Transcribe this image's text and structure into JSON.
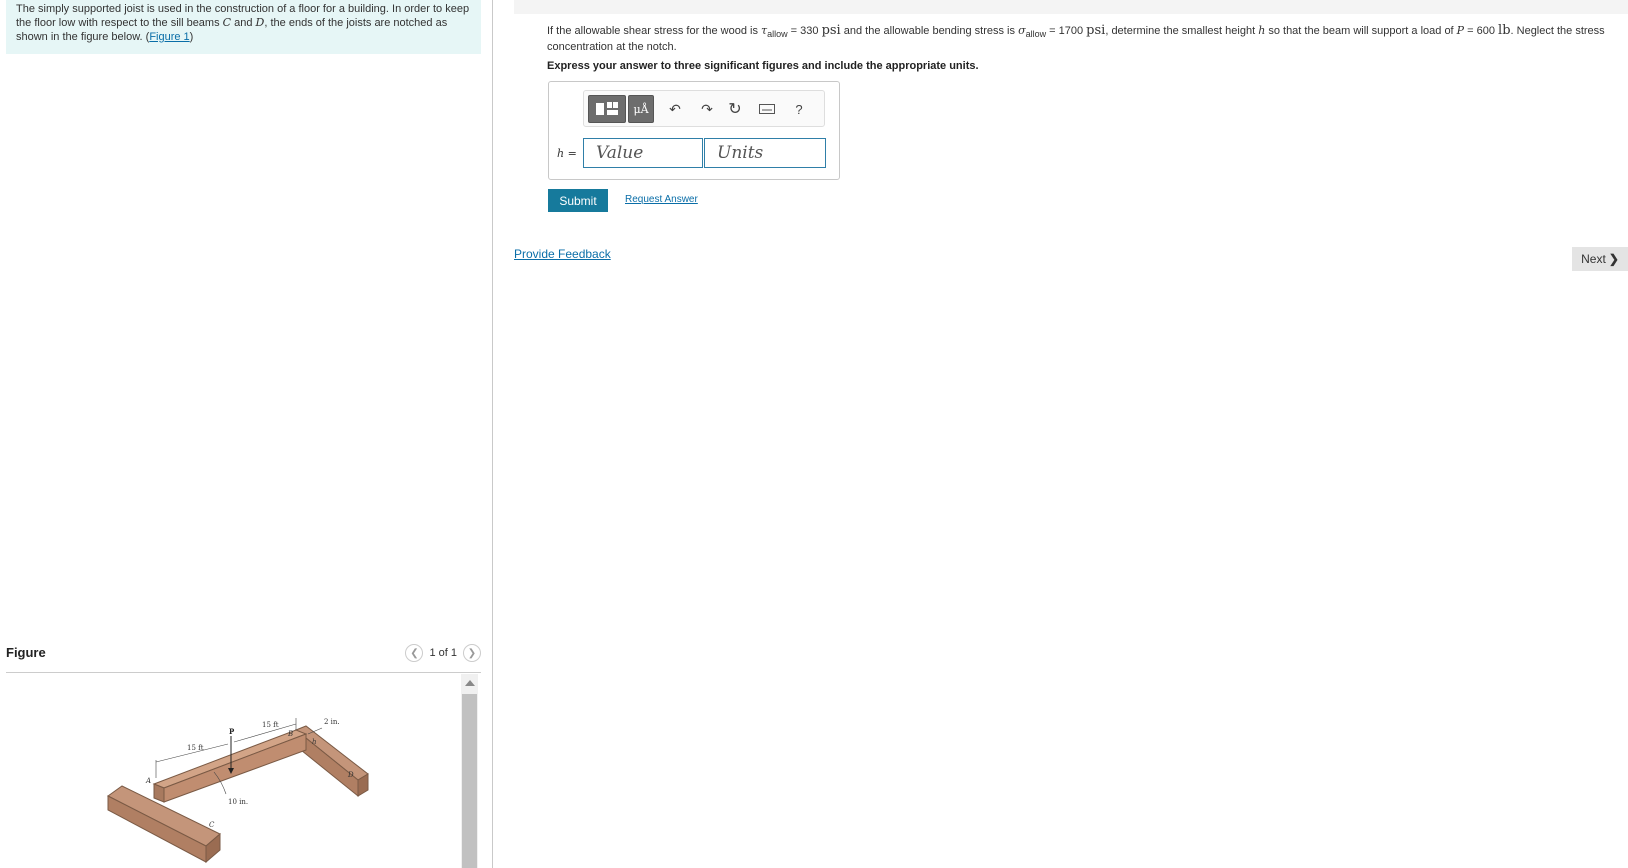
{
  "intro": {
    "text_a": "The simply supported joist is used in the construction of a floor for a building. In order to keep the floor low with respect to the sill beams ",
    "var_c": "C",
    "and": " and ",
    "var_d": "D",
    "text_b": ", the ends of the joists are notched as shown in the figure below. (",
    "figure_link": "Figure 1",
    "text_c": ")"
  },
  "figure": {
    "title": "Figure",
    "pager_text": "1 of 1",
    "labels": {
      "p": "P",
      "dim_15ft_right": "15 ft",
      "dim_15ft_left": "15 ft",
      "dim_2in": "2 in.",
      "h": "h",
      "b": "B",
      "a": "A",
      "c": "C",
      "d": "D",
      "dim_10in": "10 in."
    }
  },
  "question": {
    "p1": "If the allowable shear stress for the wood is ",
    "tau": "τ",
    "tau_sub": "allow",
    "eq1": " = 330 ",
    "unit_psi1": "psi",
    "p2": " and the allowable bending stress is ",
    "sigma": "σ",
    "sigma_sub": "allow",
    "eq2": " = 1700 ",
    "unit_psi2": "psi",
    "p3": ", determine the smallest height ",
    "var_h": "h",
    "p4": " so that the beam will support a load of ",
    "var_p": "P",
    "eq3": " = 600 ",
    "unit_lb": "lb",
    "p5": ". Neglect the stress concentration at the notch.",
    "instruction": "Express your answer to three significant figures and include the appropriate units."
  },
  "answer": {
    "label": "h =",
    "value_placeholder": "Value",
    "units_placeholder": "Units",
    "toolbar": {
      "templates_icon": "templates-icon",
      "units_label": "μÅ",
      "undo_icon": "undo-icon",
      "redo_icon": "redo-icon",
      "reset_icon": "reset-icon",
      "keyboard_icon": "keyboard-icon",
      "help_label": "?"
    }
  },
  "actions": {
    "submit": "Submit",
    "request_answer": "Request Answer",
    "provide_feedback": "Provide Feedback",
    "next": "Next"
  }
}
